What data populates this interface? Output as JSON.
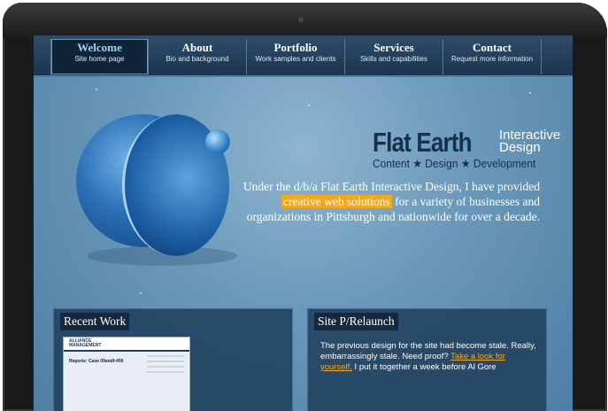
{
  "nav": {
    "items": [
      {
        "title": "Welcome",
        "subtitle": "Site home page"
      },
      {
        "title": "About",
        "subtitle": "Bio and background"
      },
      {
        "title": "Portfolio",
        "subtitle": "Work samples and clients"
      },
      {
        "title": "Services",
        "subtitle": "Skills and capabilities"
      },
      {
        "title": "Contact",
        "subtitle": "Request more information"
      }
    ]
  },
  "brand": {
    "name": "Flat Earth",
    "sub_line1": "Interactive",
    "sub_line2": "Design",
    "tagline": "Content ★ Design ★ Development"
  },
  "intro": {
    "before": "Under the d/b/a Flat Earth Interactive Design, I have provided",
    "highlight": "creative web solutions",
    "after": "for a variety of businesses and organizations in Pittsburgh and nationwide for over a decade."
  },
  "recent_work": {
    "title": "Recent Work",
    "thumb_logo": "ALLIANCE",
    "thumb_logo2": "MANAGEMENT",
    "thumb_heading": "Reports: Case 09andf-#00"
  },
  "relaunch": {
    "title": "Site P/Relaunch",
    "text_before": "The previous design for the site had become stale. Really, embarrassingly stale. Need proof?",
    "link": "Take a look for yourself.",
    "text_after": "I put it together a week before Al Gore"
  },
  "colors": {
    "accent": "#f2a91f",
    "nav_active": "#9fd0f2",
    "brand": "#16304d"
  }
}
